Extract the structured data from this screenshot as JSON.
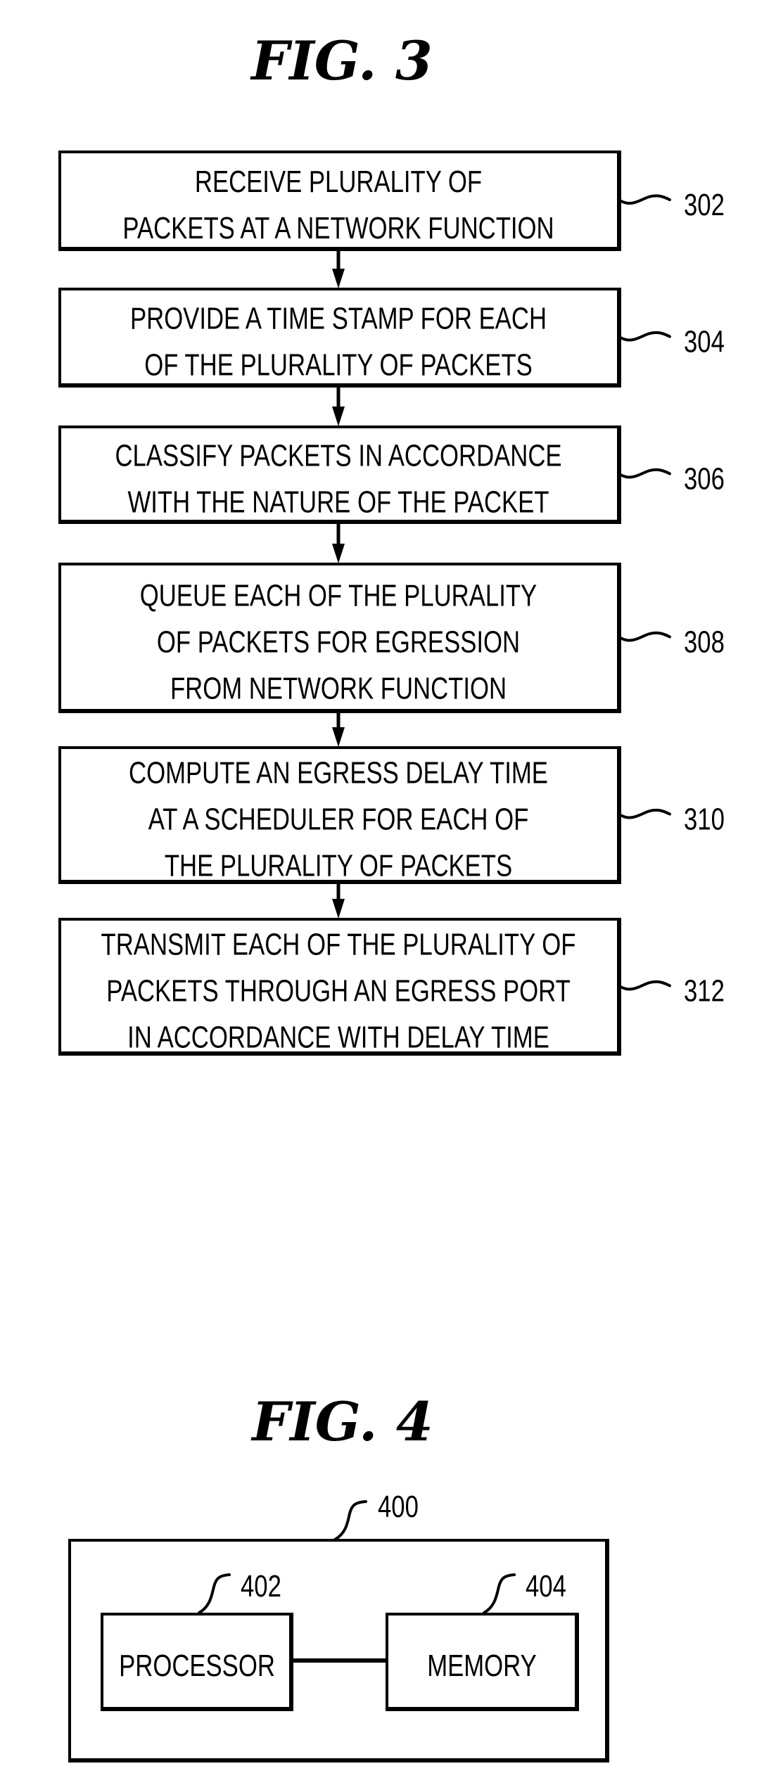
{
  "figures": [
    {
      "title": "FIG. 3",
      "type": "flowchart",
      "steps": [
        {
          "ref": "302",
          "lines": [
            "RECEIVE PLURALITY OF",
            "PACKETS AT A NETWORK FUNCTION"
          ]
        },
        {
          "ref": "304",
          "lines": [
            "PROVIDE A TIME STAMP FOR EACH",
            "OF THE PLURALITY OF PACKETS"
          ]
        },
        {
          "ref": "306",
          "lines": [
            "CLASSIFY PACKETS IN ACCORDANCE",
            "WITH THE NATURE OF THE PACKET"
          ]
        },
        {
          "ref": "308",
          "lines": [
            "QUEUE EACH OF THE PLURALITY",
            "OF PACKETS FOR EGRESSION",
            "FROM NETWORK FUNCTION"
          ]
        },
        {
          "ref": "310",
          "lines": [
            "COMPUTE AN EGRESS DELAY TIME",
            "AT A SCHEDULER FOR EACH OF",
            "THE PLURALITY OF PACKETS"
          ]
        },
        {
          "ref": "312",
          "lines": [
            "TRANSMIT EACH OF THE PLURALITY OF",
            "PACKETS THROUGH AN EGRESS PORT",
            "IN ACCORDANCE WITH DELAY TIME"
          ]
        }
      ]
    },
    {
      "title": "FIG. 4",
      "type": "block-diagram",
      "container_ref": "400",
      "blocks": [
        {
          "ref": "402",
          "label": "PROCESSOR"
        },
        {
          "ref": "404",
          "label": "MEMORY"
        }
      ],
      "connections": [
        [
          "402",
          "404"
        ]
      ]
    }
  ]
}
